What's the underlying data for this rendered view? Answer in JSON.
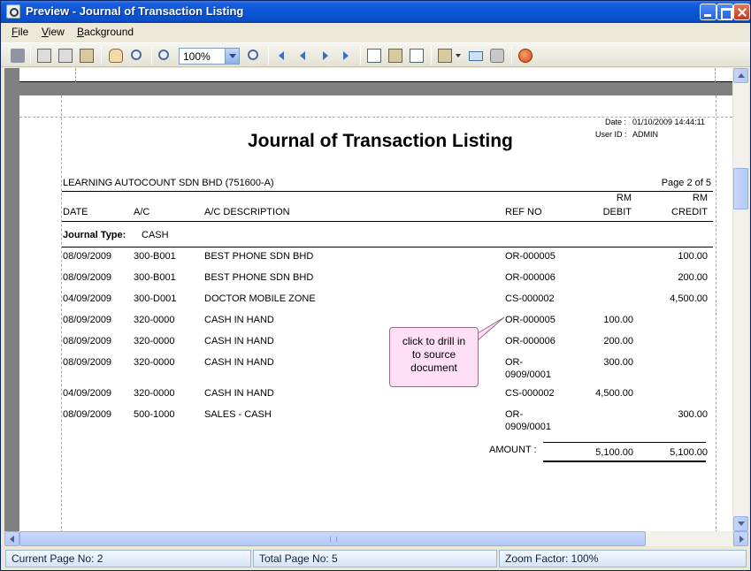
{
  "window": {
    "title": "Preview - Journal of Transaction Listing"
  },
  "menu": [
    {
      "label": "File",
      "underline": "F"
    },
    {
      "label": "View",
      "underline": "V"
    },
    {
      "label": "Background",
      "underline": "B"
    }
  ],
  "toolbar": {
    "zoom_value": "100%",
    "icons": [
      "binoculars-icon",
      "page-setup-icon",
      "print-icon",
      "print-options-icon",
      "hand-icon",
      "zoom-tool-icon",
      "zoom-out-icon",
      "zoom-in-icon",
      "first-page-icon",
      "prev-page-icon",
      "next-page-icon",
      "last-page-icon",
      "multiple-pages-icon",
      "export-icon",
      "watermark-icon",
      "save-icon",
      "email-icon",
      "disk-icon",
      "exit-icon"
    ]
  },
  "report": {
    "date_label": "Date :",
    "date_value": "01/10/2009 14:44:11",
    "user_label": "User ID :",
    "user_value": "ADMIN",
    "title": "Journal of Transaction Listing",
    "company": "LEARNING AUTOCOUNT SDN BHD (751600-A)",
    "page_info": "Page 2 of 5",
    "headers": {
      "date": "DATE",
      "ac": "A/C",
      "ac_desc": "A/C DESCRIPTION",
      "ref": "REF NO",
      "rm_debit_top": "RM",
      "debit": "DEBIT",
      "rm_credit_top": "RM",
      "credit": "CREDIT"
    },
    "journal_type_label": "Journal Type:",
    "journal_type_value": "CASH",
    "rows": [
      {
        "date": "08/09/2009",
        "ac": "300-B001",
        "desc": "BEST PHONE SDN BHD",
        "ref": [
          "OR-000005"
        ],
        "debit": "",
        "credit": "100.00"
      },
      {
        "date": "08/09/2009",
        "ac": "300-B001",
        "desc": "BEST PHONE SDN BHD",
        "ref": [
          "OR-000006"
        ],
        "debit": "",
        "credit": "200.00"
      },
      {
        "date": "04/09/2009",
        "ac": "300-D001",
        "desc": "DOCTOR MOBILE ZONE",
        "ref": [
          "CS-000002"
        ],
        "debit": "",
        "credit": "4,500.00"
      },
      {
        "date": "08/09/2009",
        "ac": "320-0000",
        "desc": "CASH IN HAND",
        "ref": [
          "OR-000005"
        ],
        "debit": "100.00",
        "credit": ""
      },
      {
        "date": "08/09/2009",
        "ac": "320-0000",
        "desc": "CASH IN HAND",
        "ref": [
          "OR-000006"
        ],
        "debit": "200.00",
        "credit": ""
      },
      {
        "date": "08/09/2009",
        "ac": "320-0000",
        "desc": "CASH IN HAND",
        "ref": [
          "OR-",
          "0909/0001"
        ],
        "debit": "300.00",
        "credit": ""
      },
      {
        "date": "04/09/2009",
        "ac": "320-0000",
        "desc": "CASH IN HAND",
        "ref": [
          "CS-000002"
        ],
        "debit": "4,500.00",
        "credit": ""
      },
      {
        "date": "08/09/2009",
        "ac": "500-1000",
        "desc": "SALES - CASH",
        "ref": [
          "OR-",
          "0909/0001"
        ],
        "debit": "",
        "credit": "300.00"
      }
    ],
    "amount_label": "AMOUNT :",
    "total_debit": "5,100.00",
    "total_credit": "5,100.00"
  },
  "callout": {
    "lines": [
      "click to drill in",
      "to source",
      "document"
    ]
  },
  "status": {
    "current_page": "Current Page No: 2",
    "total_page": "Total Page No: 5",
    "zoom_factor": "Zoom Factor: 100%"
  }
}
